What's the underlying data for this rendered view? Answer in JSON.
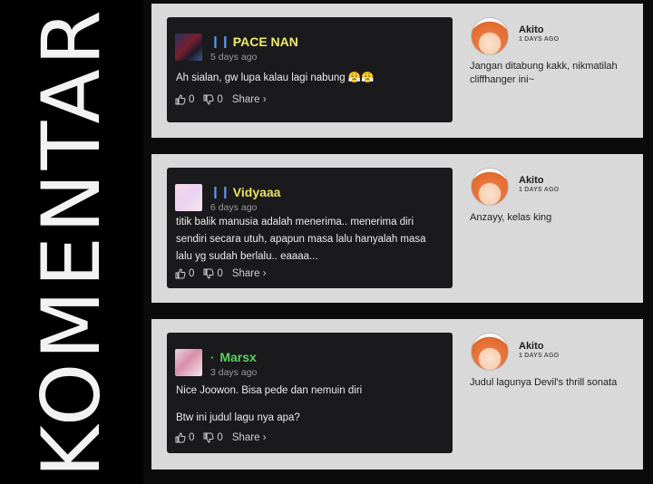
{
  "side_title": "KOMENTAR",
  "colors": {
    "pace_nan": "#f0ea66",
    "vidyaaa": "#e9e15e",
    "marsx": "#5bd15e",
    "badge": "#5b9bf0"
  },
  "comments": [
    {
      "user": "PACE NAN",
      "badge": "❙❙",
      "time": "5 days ago",
      "text": "Ah sialan, gw lupa kalau lagi nabung 😤😤",
      "likes": "0",
      "dislikes": "0",
      "share": "Share ›",
      "reply": {
        "name": "Akito",
        "time": "1 DAYS AGO",
        "text": "Jangan ditabung kakk, nikmatilah cliffhanger ini~"
      }
    },
    {
      "user": "Vidyaaa",
      "badge": "❙❙",
      "time": "6 days ago",
      "text": "titik balik manusia adalah menerima.. menerima diri sendiri secara utuh, apapun masa lalu hanyalah masa lalu yg sudah berlalu.. eaaaa...",
      "likes": "0",
      "dislikes": "0",
      "share": "Share ›",
      "reply": {
        "name": "Akito",
        "time": "1 DAYS AGO",
        "text": "Anzayy, kelas king"
      }
    },
    {
      "user": "Marsx",
      "badge": "·",
      "time": "3 days ago",
      "text_lines": [
        "Nice Joowon. Bisa pede dan nemuin diri",
        "Btw ini judul lagu nya apa?"
      ],
      "likes": "0",
      "dislikes": "0",
      "share": "Share ›",
      "reply": {
        "name": "Akito",
        "time": "1 DAYS AGO",
        "text": "Judul lagunya Devil's thrill sonata"
      }
    }
  ]
}
